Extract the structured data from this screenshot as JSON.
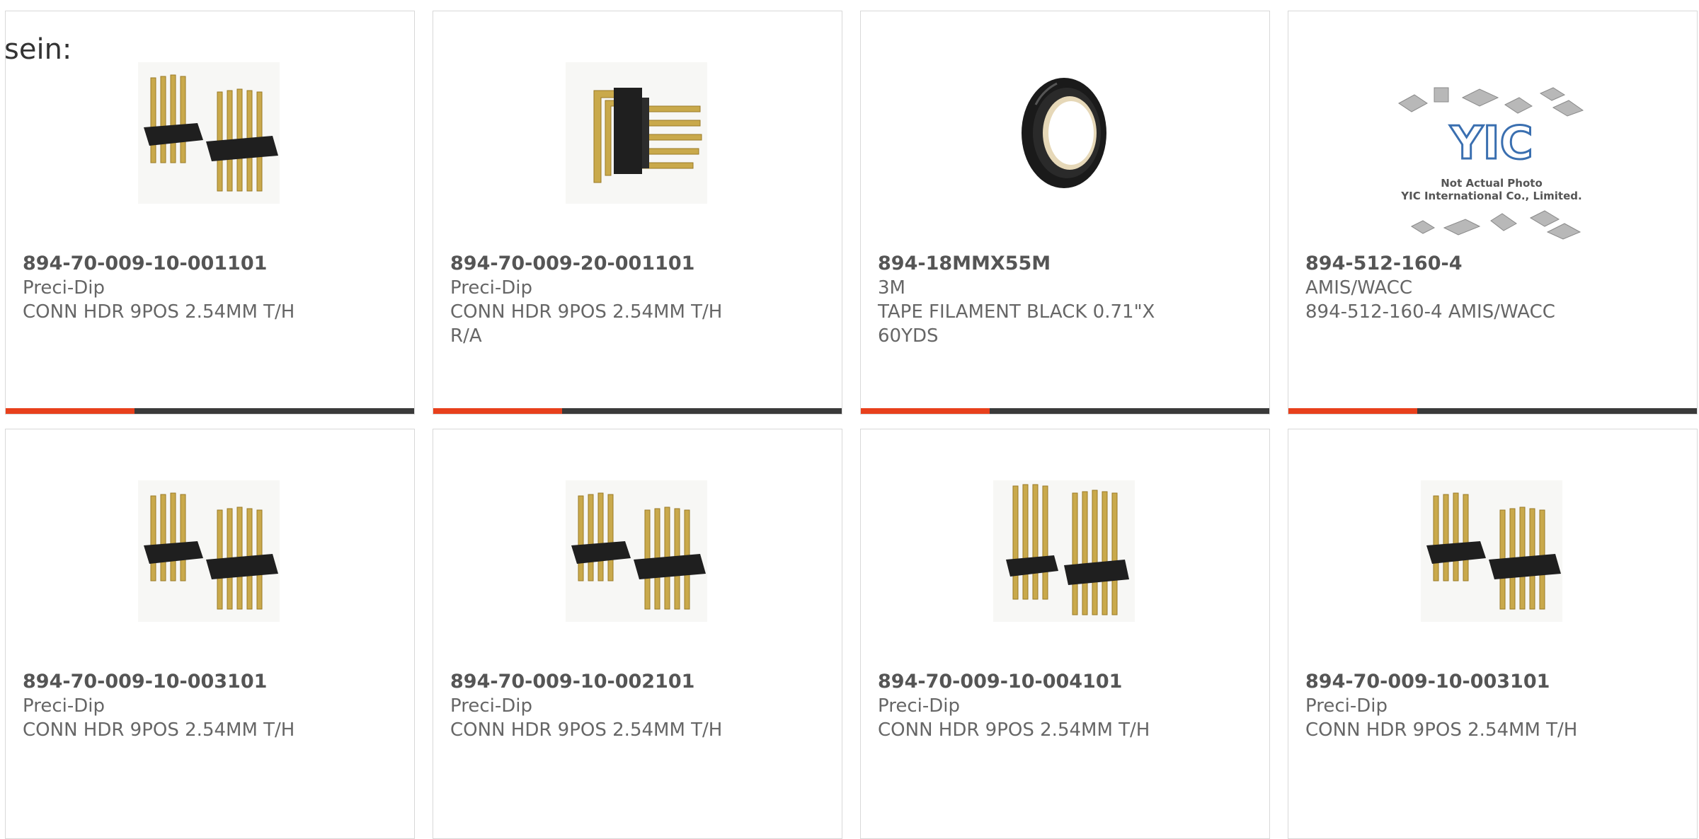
{
  "lead_text": "sein:",
  "colors": {
    "accent": "#e8401c",
    "bar_track": "#3a3a3a",
    "border": "#d8d8d8",
    "text_dark": "#555555",
    "text": "#666666"
  },
  "products": [
    {
      "part_number": "894-70-009-10-001101",
      "manufacturer": "Preci-Dip",
      "description": "CONN HDR 9POS 2.54MM T/H",
      "image": "double-row-pin-header-image",
      "bar_fraction": 0.316
    },
    {
      "part_number": "894-70-009-20-001101",
      "manufacturer": "Preci-Dip",
      "description": "CONN HDR 9POS 2.54MM T/H R/A",
      "image": "right-angle-pin-header-image",
      "bar_fraction": 0.316
    },
    {
      "part_number": "894-18MMX55M",
      "manufacturer": "3M",
      "description": "TAPE FILAMENT BLACK 0.71\"X 60YDS",
      "image": "tape-roll-image",
      "bar_fraction": 0.316
    },
    {
      "part_number": "894-512-160-4",
      "manufacturer": "AMIS/WACC",
      "description": "894-512-160-4 AMIS/WACC",
      "image": "placeholder-not-actual-photo-image",
      "placeholder": {
        "logo": "YIC",
        "line1": "Not Actual Photo",
        "line2": "YIC International Co., Limited."
      },
      "bar_fraction": 0.316
    },
    {
      "part_number": "894-70-009-10-003101",
      "manufacturer": "Preci-Dip",
      "description": "CONN HDR 9POS 2.54MM T/H",
      "image": "double-row-pin-header-image"
    },
    {
      "part_number": "894-70-009-10-002101",
      "manufacturer": "Preci-Dip",
      "description": "CONN HDR 9POS 2.54MM T/H",
      "image": "double-row-pin-header-image"
    },
    {
      "part_number": "894-70-009-10-004101",
      "manufacturer": "Preci-Dip",
      "description": "CONN HDR 9POS 2.54MM T/H",
      "image": "double-row-pin-header-long-pins-image"
    },
    {
      "part_number": "894-70-009-10-003101",
      "manufacturer": "Preci-Dip",
      "description": "CONN HDR 9POS 2.54MM T/H",
      "image": "double-row-pin-header-image"
    }
  ]
}
